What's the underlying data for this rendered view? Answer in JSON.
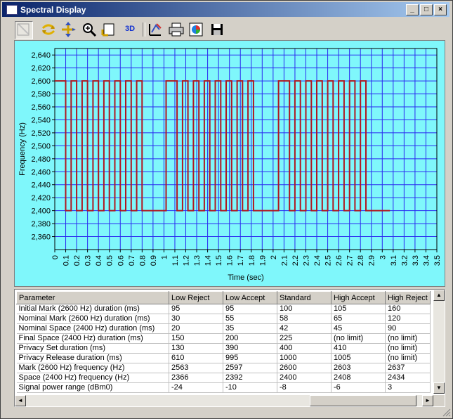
{
  "window": {
    "title": "Spectral Display"
  },
  "title_buttons": {
    "minimize": "_",
    "maximize": "□",
    "close": "×"
  },
  "toolbar": {
    "items": [
      {
        "name": "pointer-tool",
        "icon": "pointer-icon"
      },
      {
        "name": "scroll-tool",
        "icon": "scroll-arrows-icon"
      },
      {
        "name": "zoom-axis-tool",
        "icon": "axis-arrows-icon"
      },
      {
        "name": "zoom-tool",
        "icon": "magnifier-icon"
      },
      {
        "name": "export-tool",
        "icon": "page-export-icon"
      },
      {
        "name": "3d-tool",
        "icon": "3d-text-icon",
        "label": "3D"
      },
      {
        "name": "edit-tool",
        "icon": "edit-chart-icon"
      },
      {
        "name": "print-tool",
        "icon": "printer-icon"
      },
      {
        "name": "copy-tool",
        "icon": "chart-copy-icon"
      },
      {
        "name": "save-tool",
        "icon": "floppy-disk-icon"
      }
    ]
  },
  "chart_data": {
    "type": "line",
    "xlabel": "Time (sec)",
    "ylabel": "Frequency (Hz)",
    "xlim": [
      0,
      3.5
    ],
    "ylim": [
      2340,
      2650
    ],
    "yticks": [
      "2,360",
      "2,380",
      "2,400",
      "2,420",
      "2,440",
      "2,460",
      "2,480",
      "2,500",
      "2,520",
      "2,540",
      "2,560",
      "2,580",
      "2,600",
      "2,620",
      "2,640"
    ],
    "xticks": [
      "0",
      "0.1",
      "0.2",
      "0.3",
      "0.4",
      "0.5",
      "0.6",
      "0.7",
      "0.8",
      "0.9",
      "1",
      "1.1",
      "1.2",
      "1.3",
      "1.4",
      "1.5",
      "1.6",
      "1.7",
      "1.8",
      "1.9",
      "2",
      "2.1",
      "2.2",
      "2.3",
      "2.4",
      "2.5",
      "2.6",
      "2.7",
      "2.8",
      "2.9",
      "3",
      "3.1",
      "3.2",
      "3.3",
      "3.4",
      "3.5"
    ],
    "grid": true,
    "background": "#7ff7fb",
    "plot_background": "#7ff7fb",
    "grid_color": "#2a2af0",
    "line_color": "#b01820",
    "series": [
      {
        "x": [
          0,
          0.1,
          0.1,
          0.15,
          0.15,
          0.2,
          0.2,
          0.25,
          0.25,
          0.3,
          0.3,
          0.35,
          0.35,
          0.4,
          0.4,
          0.45,
          0.45,
          0.5,
          0.5,
          0.55,
          0.55,
          0.6,
          0.6,
          0.65,
          0.65,
          0.7,
          0.7,
          0.75,
          0.75,
          0.8,
          0.8,
          1.02,
          1.02,
          1.12,
          1.12,
          1.17,
          1.17,
          1.22,
          1.22,
          1.27,
          1.27,
          1.32,
          1.32,
          1.37,
          1.37,
          1.42,
          1.42,
          1.47,
          1.47,
          1.52,
          1.52,
          1.57,
          1.57,
          1.62,
          1.62,
          1.67,
          1.67,
          1.72,
          1.72,
          1.77,
          1.77,
          1.82,
          1.82,
          2.05,
          2.05,
          2.15,
          2.15,
          2.2,
          2.2,
          2.25,
          2.25,
          2.3,
          2.3,
          2.35,
          2.35,
          2.4,
          2.4,
          2.45,
          2.45,
          2.5,
          2.5,
          2.55,
          2.55,
          2.6,
          2.6,
          2.65,
          2.65,
          2.7,
          2.7,
          2.75,
          2.75,
          2.8,
          2.8,
          2.85,
          2.85,
          3.07
        ],
        "y": [
          2600,
          2600,
          2400,
          2400,
          2600,
          2600,
          2400,
          2400,
          2600,
          2600,
          2400,
          2400,
          2600,
          2600,
          2400,
          2400,
          2600,
          2600,
          2400,
          2400,
          2600,
          2600,
          2400,
          2400,
          2600,
          2600,
          2400,
          2400,
          2600,
          2600,
          2400,
          2400,
          2600,
          2600,
          2400,
          2400,
          2600,
          2600,
          2400,
          2400,
          2600,
          2600,
          2400,
          2400,
          2600,
          2600,
          2400,
          2400,
          2600,
          2600,
          2400,
          2400,
          2600,
          2600,
          2400,
          2400,
          2600,
          2600,
          2400,
          2400,
          2600,
          2600,
          2400,
          2400,
          2600,
          2600,
          2400,
          2400,
          2600,
          2600,
          2400,
          2400,
          2600,
          2600,
          2400,
          2400,
          2600,
          2600,
          2400,
          2400,
          2600,
          2600,
          2400,
          2400,
          2600,
          2600,
          2400,
          2400,
          2600,
          2600,
          2400,
          2400,
          2600,
          2600,
          2400,
          2400
        ]
      }
    ]
  },
  "table": {
    "columns": [
      "Parameter",
      "Low Reject",
      "Low Accept",
      "Standard",
      "High Accept",
      "High Reject"
    ],
    "rows": [
      [
        "Initial Mark (2600 Hz) duration (ms)",
        "95",
        "95",
        "100",
        "105",
        "160"
      ],
      [
        "Nominal Mark (2600 Hz) duration (ms)",
        "30",
        "55",
        "58",
        "65",
        "120"
      ],
      [
        "Nominal Space (2400 Hz) duration (ms)",
        "20",
        "35",
        "42",
        "45",
        "90"
      ],
      [
        "Final Space (2400 Hz) duration (ms)",
        "150",
        "200",
        "225",
        "(no limit)",
        "(no limit)"
      ],
      [
        "Privacy Set duration (ms)",
        "130",
        "390",
        "400",
        "410",
        "(no limit)"
      ],
      [
        "Privacy Release duration (ms)",
        "610",
        "995",
        "1000",
        "1005",
        "(no limit)"
      ],
      [
        "Mark (2600 Hz) frequency (Hz)",
        "2563",
        "2597",
        "2600",
        "2603",
        "2637"
      ],
      [
        "Space (2400 Hz) frequency (Hz)",
        "2366",
        "2392",
        "2400",
        "2408",
        "2434"
      ],
      [
        "Signal power range (dBm0)",
        "-24",
        "-10",
        "-8",
        "-6",
        "3"
      ]
    ]
  },
  "scroll": {
    "up": "▲",
    "down": "▼",
    "left": "◄",
    "right": "►"
  }
}
